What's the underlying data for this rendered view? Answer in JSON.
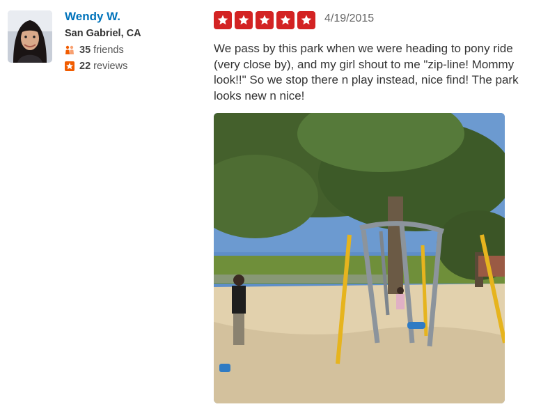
{
  "reviewer": {
    "name": "Wendy W.",
    "location": "San Gabriel, CA",
    "friends_count": "35",
    "friends_label": "friends",
    "reviews_count": "22",
    "reviews_label": "reviews",
    "avatar_icon": "user-avatar-photo"
  },
  "review": {
    "rating": 5,
    "rating_max": 5,
    "date": "4/19/2015",
    "text": "We pass by this park when we were heading to pony ride (very close by), and my girl shout to me \"zip-line! Mommy look!!\" So we stop there n play instead, nice find!  The park looks new n nice!",
    "photo_icon": "park-playground-photo"
  },
  "colors": {
    "star_red": "#d32323",
    "name_blue": "#0073bb",
    "friends_orange": "#f15c00",
    "reviews_orange": "#f15c00"
  }
}
